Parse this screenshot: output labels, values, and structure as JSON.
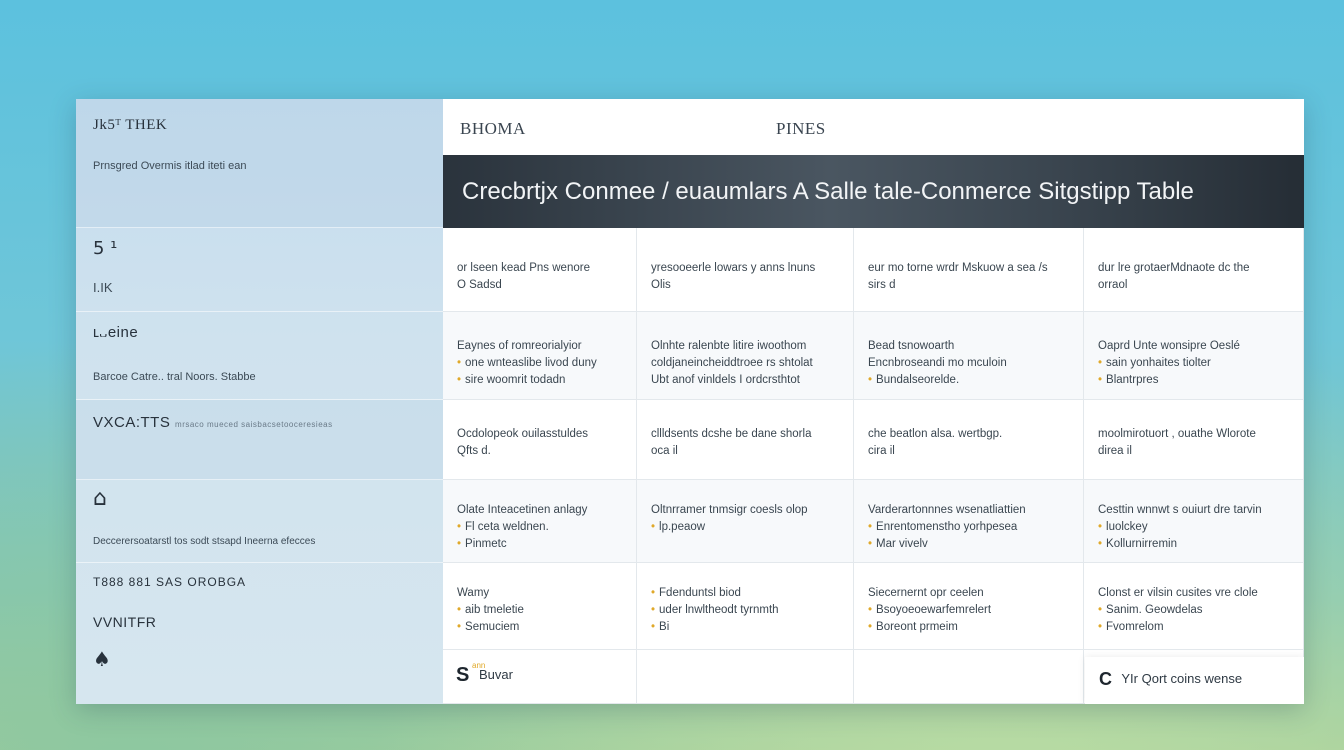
{
  "sidebar": {
    "brand": "Jk5ᵀ THEK",
    "brand_sub": "Prnsgred Overmis itlad iteti ean",
    "s1_icon": "5 ¹",
    "s1_label": "I.IK",
    "s2_label": "ʟ᎑eine",
    "s2_sub": "Barcoe Catre.. tral Noors. Stabbe",
    "s3_title": "VXCA:TTS",
    "s3_sub": "mrsaco mueced saisbacsetooceresieas",
    "s4_sub": "Deccerersoatarstl tos sodt stsapd Ineerna efecces",
    "s5_title": "T888 881 SAS OROBGA",
    "s5_label": "VVNITFR"
  },
  "header": {
    "left": "BHOMA",
    "center": "PINES"
  },
  "title": "Crecbrtjx Conmee / euaumlars A Salle tale-Conmerce Sitgstipp Table",
  "rows": [
    [
      {
        "lines": [
          "or lseen kead Pns wenore",
          "O Sadsd"
        ],
        "bullets": [
          false,
          false
        ]
      },
      {
        "lines": [
          "yresooeerle lowars y anns lnuns",
          "Olis"
        ],
        "bullets": [
          false,
          false
        ]
      },
      {
        "lines": [
          "eur mo torne wrdr Mskuow a sea /s",
          "sirs d"
        ],
        "bullets": [
          false,
          false
        ]
      },
      {
        "lines": [
          "dur lre grotaerMdnaote dc the",
          "orraol"
        ],
        "bullets": [
          false,
          false
        ]
      }
    ],
    [
      {
        "lines": [
          "Eaynes of romreorialyior",
          "one wnteaslibe livod duny",
          "sire woomrit todadn"
        ],
        "bullets": [
          false,
          true,
          true
        ]
      },
      {
        "lines": [
          "Olnhte ralenbte litire iwoothom",
          "coldjaneincheiddtroee rs shtolat",
          "Ubt anof vinldels I ordcrsthtot"
        ],
        "bullets": [
          false,
          false,
          false
        ]
      },
      {
        "lines": [
          "Bead tsnowoarth",
          "Encnbroseandi mo mculoin",
          "Bundalseorelde."
        ],
        "bullets": [
          false,
          false,
          true
        ]
      },
      {
        "lines": [
          "Oaprd Unte wonsipre Oeslé",
          "sain yonhaites tiolter",
          "Blantrpres"
        ],
        "bullets": [
          false,
          true,
          true
        ]
      }
    ],
    [
      {
        "lines": [
          "Ocdolopeok ouilasstuldes",
          "Qfts d."
        ],
        "bullets": [
          false,
          false
        ]
      },
      {
        "lines": [
          "cllldsents dcshe be dane shorla",
          "oca il"
        ],
        "bullets": [
          false,
          false
        ]
      },
      {
        "lines": [
          "che beatlon alsa. wertbgp.",
          "cira il"
        ],
        "bullets": [
          false,
          false
        ]
      },
      {
        "lines": [
          "moolmirotuort ,    ouathe Wlorote",
          "direa il"
        ],
        "bullets": [
          false,
          false
        ]
      }
    ],
    [
      {
        "lines": [
          "Olate Inteacetinen anlagy",
          "Fl ceta weldnen.",
          "Pinmetc"
        ],
        "bullets": [
          false,
          true,
          true
        ]
      },
      {
        "lines": [
          "Oltnrramer tnmsigr coesls olop",
          "lp.peaow"
        ],
        "bullets": [
          false,
          true
        ]
      },
      {
        "lines": [
          "Varderartonnnes wsenatliattien",
          "Enrentomenstho yorhpesea",
          "Mar vivelv"
        ],
        "bullets": [
          false,
          true,
          true
        ]
      },
      {
        "lines": [
          "Cesttin wnnwt s ouiurt dre tarvin",
          "luolckey",
          "Kollurnirremin"
        ],
        "bullets": [
          false,
          true,
          true
        ]
      }
    ],
    [
      {
        "lines": [
          "Wamy",
          "aib tmeletie",
          "Semuciem"
        ],
        "bullets": [
          false,
          true,
          true
        ]
      },
      {
        "lines": [
          "Fdenduntsl biod",
          "uder lnwltheodt tyrnmth",
          "Bi"
        ],
        "bullets": [
          true,
          true,
          true
        ]
      },
      {
        "lines": [
          "Siecernernt opr ceelen",
          "Bsoyoeoewarfemrelert",
          "Boreont prmeim"
        ],
        "bullets": [
          false,
          true,
          true
        ]
      },
      {
        "lines": [
          "Clonst er vilsin cusites vre clole",
          "Sanim. Geowdelas",
          "Fvomrelom"
        ],
        "bullets": [
          false,
          true,
          true
        ]
      }
    ]
  ],
  "footer": {
    "left_icon": "S",
    "left_tiny": "ann",
    "left_label": "Buvar",
    "right_icon": "C",
    "right_label": "YIr Qort coins wense"
  }
}
